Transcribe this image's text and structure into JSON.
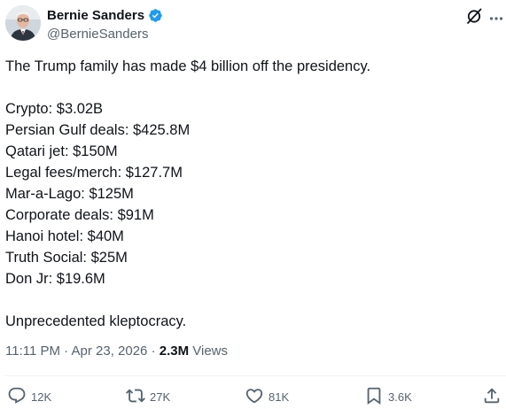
{
  "author": {
    "display_name": "Bernie Sanders",
    "handle": "@BernieSanders",
    "verified": true
  },
  "tweet": {
    "intro": "The Trump family has made $4 billion off the presidency.",
    "items": [
      "Crypto: $3.02B",
      "Persian Gulf deals: $425.8M",
      "Qatari jet: $150M",
      "Legal fees/merch: $127.7M",
      "Mar-a-Lago: $125M",
      "Corporate deals: $91M",
      "Hanoi hotel: $40M",
      "Truth Social: $25M",
      "Don Jr: $19.6M"
    ],
    "closing": "Unprecedented kleptocracy."
  },
  "meta": {
    "time": "11:11 PM",
    "separator": " · ",
    "date": "Apr 23, 2026",
    "views_count": "2.3M",
    "views_label": " Views"
  },
  "actions": {
    "replies": "12K",
    "reposts": "27K",
    "likes": "81K",
    "bookmarks": "3.6K"
  },
  "colors": {
    "text": "#0f1419",
    "secondary": "#536471",
    "verified": "#1d9bf0",
    "divider": "#eff3f4"
  },
  "icons": {
    "verified": "verified-badge-icon",
    "grok": "grok-icon",
    "more": "more-icon",
    "reply": "reply-icon",
    "repost": "repost-icon",
    "like": "heart-icon",
    "bookmark": "bookmark-icon",
    "share": "share-icon"
  }
}
